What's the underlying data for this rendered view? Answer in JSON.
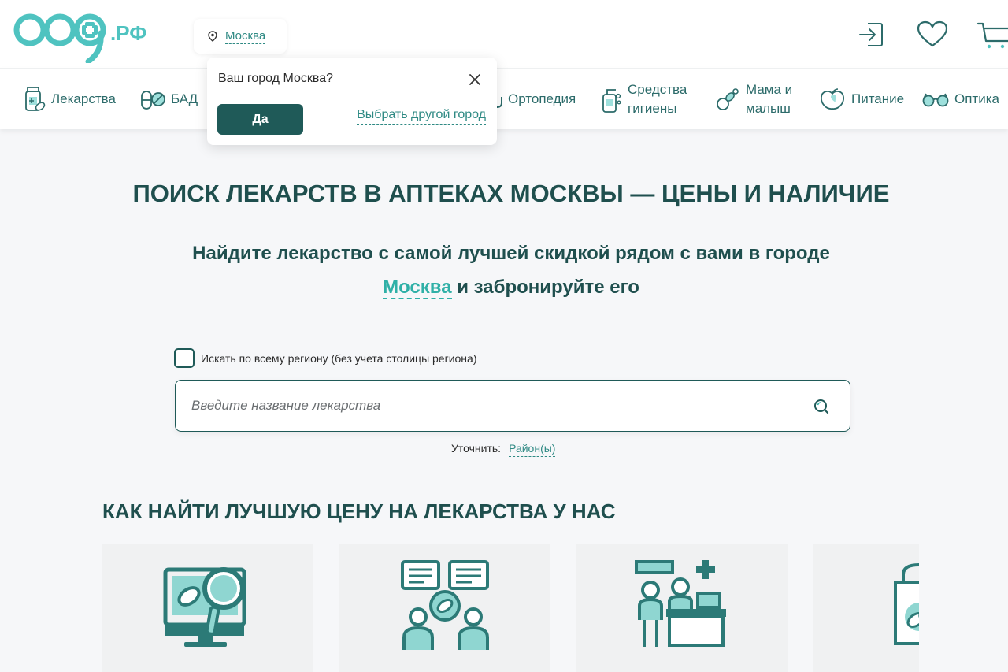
{
  "header": {
    "logo_text": "009.РФ",
    "city": "Москва",
    "icons": [
      "login-icon",
      "favorites-heart-icon",
      "cart-icon"
    ]
  },
  "nav": {
    "items": [
      {
        "label": "Лекарства",
        "icon": "pills-bottle-icon"
      },
      {
        "label": "БАД",
        "icon": "capsules-icon"
      },
      {
        "label": "Ортопедия",
        "icon": "orthopedics-icon"
      },
      {
        "label": "Средства гигиены",
        "icon": "soap-icon"
      },
      {
        "label": "Мама и малыш",
        "icon": "pacifier-icon"
      },
      {
        "label": "Питание",
        "icon": "apple-heart-icon"
      },
      {
        "label": "Оптика",
        "icon": "glasses-icon"
      }
    ]
  },
  "city_popup": {
    "question": "Ваш город Москва?",
    "yes_label": "Да",
    "other_label": "Выбрать другой город"
  },
  "hero": {
    "title": "ПОИСК ЛЕКАРСТВ В АПТЕКАХ МОСКВЫ — ЦЕНЫ И НАЛИЧИЕ",
    "subtitle_line1": "Найдите лекарство с самой лучшей скидкой рядом с вами в городе",
    "subtitle_city": "Москва",
    "subtitle_line2_rest": " и забронируйте его"
  },
  "search": {
    "region_checkbox_label": "Искать по всему региону (без учета столицы региона)",
    "placeholder": "Введите название лекарства",
    "refine_label": "Уточнить:",
    "refine_link": "Район(ы)"
  },
  "how": {
    "title": "КАК НАЙТИ ЛУЧШУЮ ЦЕНУ НА ЛЕКАРСТВА У НАС",
    "cards": [
      {
        "icon": "monitor-search-icon"
      },
      {
        "icon": "chat-consultation-icon"
      },
      {
        "icon": "pharmacy-counter-icon"
      },
      {
        "icon": "shopping-bag-pills-icon"
      }
    ]
  },
  "colors": {
    "accent": "#2fb0a7",
    "dark": "#1f5a58",
    "text": "#1f4f4e"
  }
}
